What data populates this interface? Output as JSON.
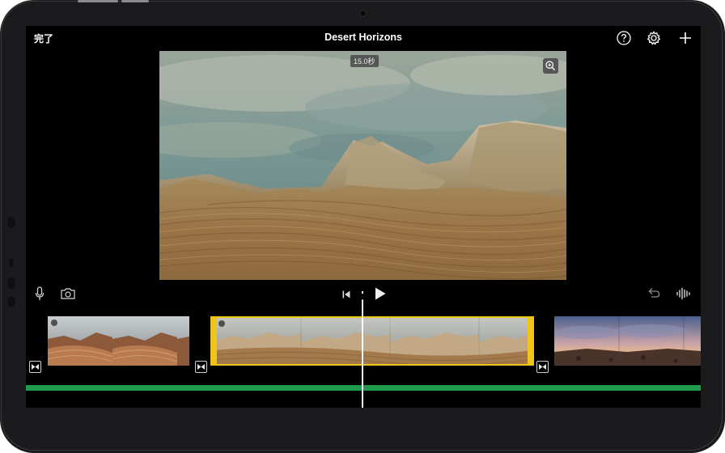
{
  "header": {
    "done_label": "完了",
    "project_title": "Desert Horizons",
    "help_icon": "help-icon",
    "settings_icon": "gear-icon",
    "add_icon": "plus-icon"
  },
  "viewer": {
    "duration_label": "15.0秒",
    "zoom_icon": "zoom-in-icon"
  },
  "toolbar": {
    "voiceover_icon": "microphone-icon",
    "camera_icon": "camera-icon",
    "rewind_icon": "skip-back-icon",
    "play_icon": "play-icon",
    "undo_icon": "undo-icon",
    "audio_icon": "waveform-icon"
  },
  "timeline": {
    "clips": [
      {
        "name": "desert-clip-1",
        "selected": false
      },
      {
        "name": "white-pocket-clip",
        "selected": true
      },
      {
        "name": "sunset-clip",
        "selected": false
      }
    ],
    "transition_icon": "transition-icon",
    "audio_track_color": "#1f9a4a",
    "selection_color": "#f0c419"
  },
  "colors": {
    "background": "#000000",
    "bezel": "#1b1b1d",
    "accent": "#f0c419"
  }
}
